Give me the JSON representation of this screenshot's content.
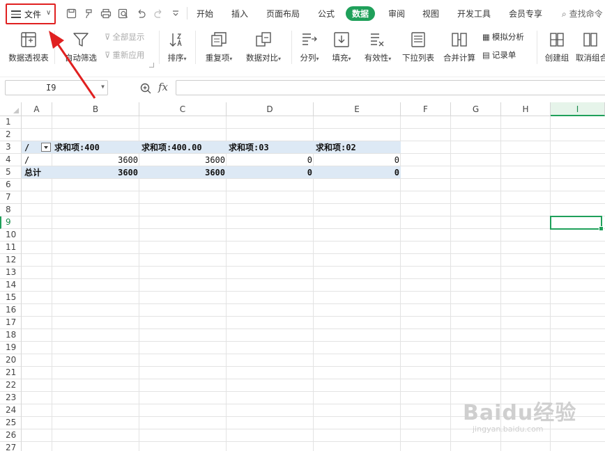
{
  "menubar": {
    "file_label": "文件",
    "quick_access_icons": [
      "save-icon",
      "format-painter-icon",
      "print-icon",
      "print-preview-icon",
      "undo-icon",
      "redo-icon",
      "more-icon"
    ],
    "tabs": [
      "开始",
      "插入",
      "页面布局",
      "公式",
      "数据",
      "审阅",
      "视图",
      "开发工具",
      "会员专享"
    ],
    "active_tab": "数据",
    "search_label": "查找命令"
  },
  "ribbon": {
    "pivot_table": "数据透视表",
    "auto_filter": "自动筛选",
    "show_all": "全部显示",
    "reapply": "重新应用",
    "sort": "排序",
    "duplicates": "重复项",
    "compare": "数据对比",
    "split": "分列",
    "fill": "填充",
    "validity": "有效性",
    "dropdown_list": "下拉列表",
    "consolidate": "合并计算",
    "what_if": "模拟分析",
    "record_form": "记录单",
    "create_group": "创建组",
    "ungroup": "取消组合"
  },
  "formula_bar": {
    "name_box": "I9",
    "fx_label": "fx",
    "formula": ""
  },
  "sheet": {
    "columns": [
      "A",
      "B",
      "C",
      "D",
      "E",
      "F",
      "G",
      "H",
      "I"
    ],
    "selected_column": "I",
    "rows": [
      "1",
      "2",
      "3",
      "4",
      "5",
      "6",
      "7",
      "8",
      "9",
      "10",
      "11",
      "12",
      "13",
      "14",
      "15",
      "16",
      "17",
      "18",
      "19",
      "20",
      "21",
      "22",
      "23",
      "24",
      "25",
      "26",
      "27"
    ],
    "selected_row": "9",
    "pivot": {
      "header": [
        "/",
        "求和项:400",
        "求和项:400.00",
        "求和项:03",
        "求和项:02"
      ],
      "row4": [
        "/",
        "3600",
        "3600",
        "0",
        "0"
      ],
      "total": [
        "总计",
        "3600",
        "3600",
        "0",
        "0"
      ]
    }
  },
  "watermark": {
    "brand": "Baidu经验",
    "url": "jingyan.baidu.com"
  },
  "colors": {
    "accent_green": "#1fa05a",
    "annotation_red": "#e02020",
    "pivot_band": "#dde9f5"
  }
}
